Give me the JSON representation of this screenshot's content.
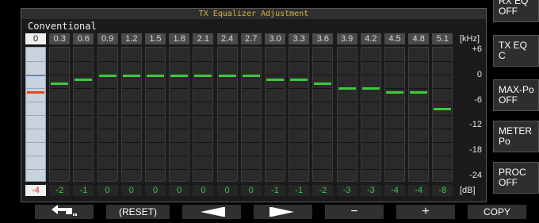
{
  "panel": {
    "title": "TX Equalizer Adjustment",
    "mode": "Conventional"
  },
  "freq_unit": "[kHz]",
  "db_unit": "[dB]",
  "scale_labels": [
    "+6",
    "0",
    "-6",
    "-12",
    "-18",
    "-24"
  ],
  "bands": [
    {
      "freq": "0",
      "value": -4,
      "label": "-4"
    },
    {
      "freq": "0.3",
      "value": -2,
      "label": "-2"
    },
    {
      "freq": "0.6",
      "value": -1,
      "label": "-1"
    },
    {
      "freq": "0.9",
      "value": 0,
      "label": "0"
    },
    {
      "freq": "1.2",
      "value": 0,
      "label": "0"
    },
    {
      "freq": "1.5",
      "value": 0,
      "label": "0"
    },
    {
      "freq": "1.8",
      "value": 0,
      "label": "0"
    },
    {
      "freq": "2.1",
      "value": 0,
      "label": "0"
    },
    {
      "freq": "2.4",
      "value": 0,
      "label": "0"
    },
    {
      "freq": "2.7",
      "value": 0,
      "label": "0"
    },
    {
      "freq": "3.0",
      "value": -1,
      "label": "-1"
    },
    {
      "freq": "3.3",
      "value": -1,
      "label": "-1"
    },
    {
      "freq": "3.6",
      "value": -2,
      "label": "-2"
    },
    {
      "freq": "3.9",
      "value": -3,
      "label": "-3"
    },
    {
      "freq": "4.2",
      "value": -3,
      "label": "-3"
    },
    {
      "freq": "4.5",
      "value": -4,
      "label": "-4"
    },
    {
      "freq": "4.8",
      "value": -4,
      "label": "-4"
    },
    {
      "freq": "5.1",
      "value": -8,
      "label": "-8"
    }
  ],
  "selected_index": 0,
  "side_menu": [
    {
      "line1": "RX EQ",
      "line2": "OFF"
    },
    {
      "line1": "TX EQ",
      "line2": "C"
    },
    {
      "line1": "MAX-Po",
      "line2": "OFF"
    },
    {
      "line1": "METER",
      "line2": "Po"
    },
    {
      "line1": "PROC",
      "line2": "OFF"
    }
  ],
  "softkeys": {
    "back": "back-arrow-icon",
    "reset": "(RESET)",
    "prev": "left-arrow-icon",
    "next": "right-arrow-icon",
    "minus": "−",
    "plus": "+",
    "copy": "COPY"
  },
  "colors": {
    "bar": "#3ccb3c",
    "selected_bar": "#e04a1e",
    "title": "#d4b040"
  }
}
